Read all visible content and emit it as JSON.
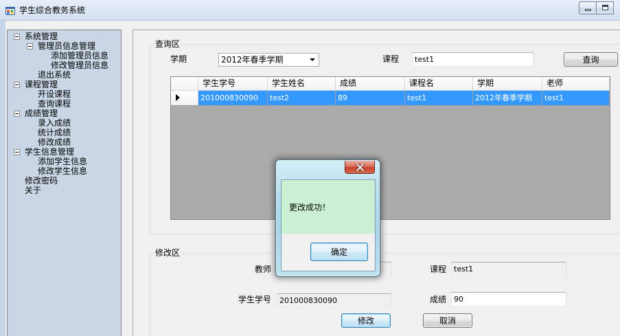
{
  "window": {
    "title": "学生综合教务系统"
  },
  "icons": {
    "app": "app-icon",
    "minimize": "minimize-icon",
    "maximize": "maximize-icon",
    "tree_expander": "collapse-icon",
    "combo_dropdown": "chevron-down-icon",
    "current_row": "triangle-right-icon",
    "dialog_close": "close-icon"
  },
  "colors": {
    "tree_background": "#c9d6e5",
    "selection": "#3399ff",
    "grid_background": "#ababab",
    "dialog_message_background": "#cbefd2",
    "dialog_close": "#c7402e"
  },
  "navigation": {
    "tree": [
      {
        "label": "系统管理",
        "expanded": true,
        "children": [
          {
            "label": "管理员信息管理",
            "expanded": true,
            "children": [
              {
                "label": "添加管理员信息"
              },
              {
                "label": "修改管理员信息"
              }
            ]
          },
          {
            "label": "退出系统"
          }
        ]
      },
      {
        "label": "课程管理",
        "expanded": true,
        "children": [
          {
            "label": "开设课程"
          },
          {
            "label": "查询课程"
          }
        ]
      },
      {
        "label": "成绩管理",
        "expanded": true,
        "children": [
          {
            "label": "录入成绩"
          },
          {
            "label": "统计成绩"
          },
          {
            "label": "修改成绩"
          }
        ]
      },
      {
        "label": "学生信息管理",
        "expanded": true,
        "children": [
          {
            "label": "添加学生信息"
          },
          {
            "label": "修改学生信息"
          }
        ]
      },
      {
        "label": "修改密码"
      },
      {
        "label": "关于"
      }
    ]
  },
  "query": {
    "group_title": "查询区",
    "term_label": "学期",
    "term_value": "2012年春季学期",
    "course_label": "课程",
    "course_value": "test1",
    "search_button": "查询",
    "grid": {
      "columns": [
        "学生学号",
        "学生姓名",
        "成绩",
        "课程名",
        "学期",
        "老师"
      ],
      "rows": [
        {
          "selected": true,
          "current": true,
          "cells": [
            "201000830090",
            "test2",
            "89",
            "test1",
            "2012年春季学期",
            "test1"
          ]
        }
      ]
    }
  },
  "modify": {
    "group_title": "修改区",
    "teacher_label": "教师",
    "course_label": "课程",
    "course_value": "test1",
    "student_id_label": "学生学号",
    "student_id_value": "201000830090",
    "score_label": "成绩",
    "score_value": "90",
    "modify_button": "修改",
    "cancel_button": "取消"
  },
  "dialog": {
    "message": "更改成功！",
    "ok_button": "确定"
  }
}
